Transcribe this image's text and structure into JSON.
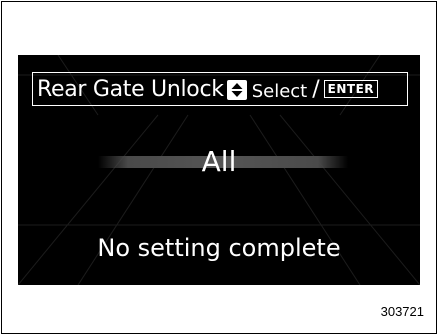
{
  "screen": {
    "header": {
      "title": "Rear Gate Unlock",
      "updown_icon": "up-down-arrows-icon",
      "select_label": "Select",
      "separator": "/",
      "enter_label": "ENTER"
    },
    "value": "All",
    "status": "No setting complete"
  },
  "figure_number": "303721",
  "colors": {
    "screen_background": "#000000",
    "text": "#ffffff",
    "page_background": "#ffffff"
  }
}
